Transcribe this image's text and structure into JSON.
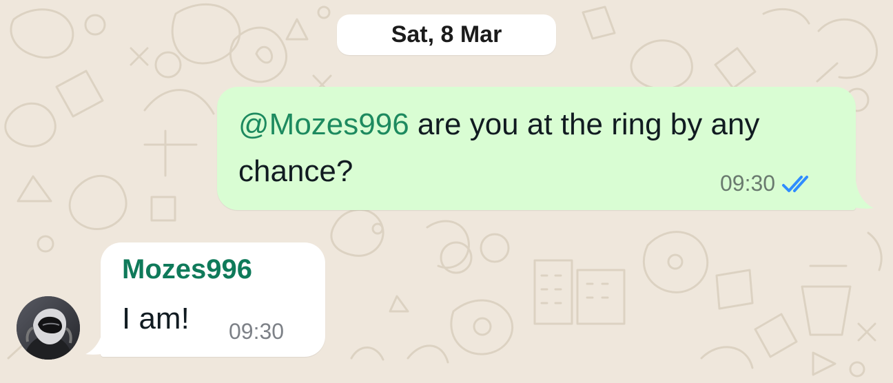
{
  "chat": {
    "date_label": "Sat, 8 Mar",
    "outgoing": {
      "mention": "@Mozes996",
      "text": " are you at the ring by any chance?",
      "time": "09:30",
      "status_icon": "double-check-read-icon",
      "status_color": "#2f8cff",
      "bubble_color": "#d9fdd3"
    },
    "incoming": {
      "sender": "Mozes996",
      "text": "I am!",
      "time": "09:30",
      "sender_color": "#0f7a5a",
      "bubble_color": "#ffffff"
    },
    "avatar_icon": "user-avatar-icon",
    "wallpaper_color": "#efe7dc"
  }
}
